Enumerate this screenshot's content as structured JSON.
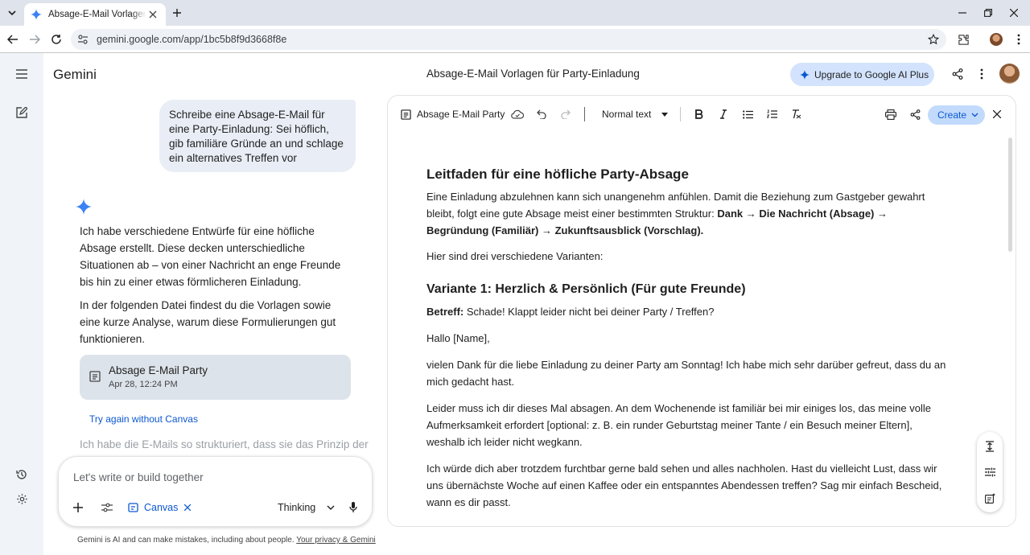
{
  "browser": {
    "tab_title": "Absage-E-Mail Vorlagen für Party-Einladung",
    "url": "gemini.google.com/app/1bc5b8f9d3668f8e"
  },
  "colors": {
    "accent": "#0b57d0",
    "upgrade_bg": "#d3e3fd",
    "rail_bg": "#f0f4f9",
    "user_bubble": "#e9eef6"
  },
  "app": {
    "brand": "Gemini",
    "conversation_title": "Absage-E-Mail Vorlagen für Party-Einladung",
    "upgrade_label": "Upgrade to Google AI Plus"
  },
  "chat": {
    "user_message": "Schreibe eine Absage-E-Mail für eine Party-Einladung: Sei höflich, gib familiäre Gründe an und schlage ein alternatives Treffen vor",
    "response_p1": "Ich habe verschiedene Entwürfe für eine höfliche Absage erstellt. Diese decken unterschiedliche Situationen ab – von einer Nachricht an enge Freunde bis hin zu einer etwas förmlicheren Einladung.",
    "response_p2": "In der folgenden Datei findest du die Vorlagen sowie eine kurze Analyse, warum diese Formulierungen gut funktionieren.",
    "card_title": "Absage E-Mail Party",
    "card_date": "Apr 28, 12:24 PM",
    "retry_label": "Try again without Canvas",
    "faded_text": "Ich habe die E-Mails so strukturiert, dass sie das Prinzip der",
    "input_placeholder": "Let's write or build together",
    "canvas_chip": "Canvas",
    "mode_label": "Thinking",
    "disclaimer": "Gemini is AI and can make mistakes, including about people.",
    "privacy_link": "Your privacy & Gemini"
  },
  "canvas": {
    "doc_name": "Absage E-Mail Party",
    "text_style": "Normal text",
    "create_label": "Create",
    "h1": "Leitfaden für eine höfliche Party-Absage",
    "intro_a": "Eine Einladung abzulehnen kann sich unangenehm anfühlen. Damit die Beziehung zum Gastgeber gewahrt bleibt, folgt eine gute Absage meist einer bestimmten Struktur:",
    "intro_b": "Dank → Die Nachricht (Absage) → Begründung (Familiär) → Zukunftsausblick (Vorschlag).",
    "variants_intro": "Hier sind drei verschiedene Varianten:",
    "h2": "Variante 1: Herzlich & Persönlich (Für gute Freunde)",
    "subject_label": "Betreff:",
    "subject_text": "Schade! Klappt leider nicht bei deiner Party / Treffen?",
    "greeting": "Hallo [Name],",
    "p1": "vielen Dank für die liebe Einladung zu deiner Party am Sonntag! Ich habe mich sehr darüber gefreut, dass du an mich gedacht hast.",
    "p2": "Leider muss ich dir dieses Mal absagen. An dem Wochenende ist familiär bei mir einiges los, das meine volle Aufmerksamkeit erfordert [optional: z. B. ein runder Geburtstag meiner Tante / ein Besuch meiner Eltern], weshalb ich leider nicht wegkann.",
    "p3": "Ich würde dich aber trotzdem furchtbar gerne bald sehen und alles nachholen. Hast du vielleicht Lust, dass wir uns übernächste Woche auf einen Kaffee oder ein entspanntes Abendessen treffen? Sag mir einfach Bescheid, wann es dir passt."
  }
}
